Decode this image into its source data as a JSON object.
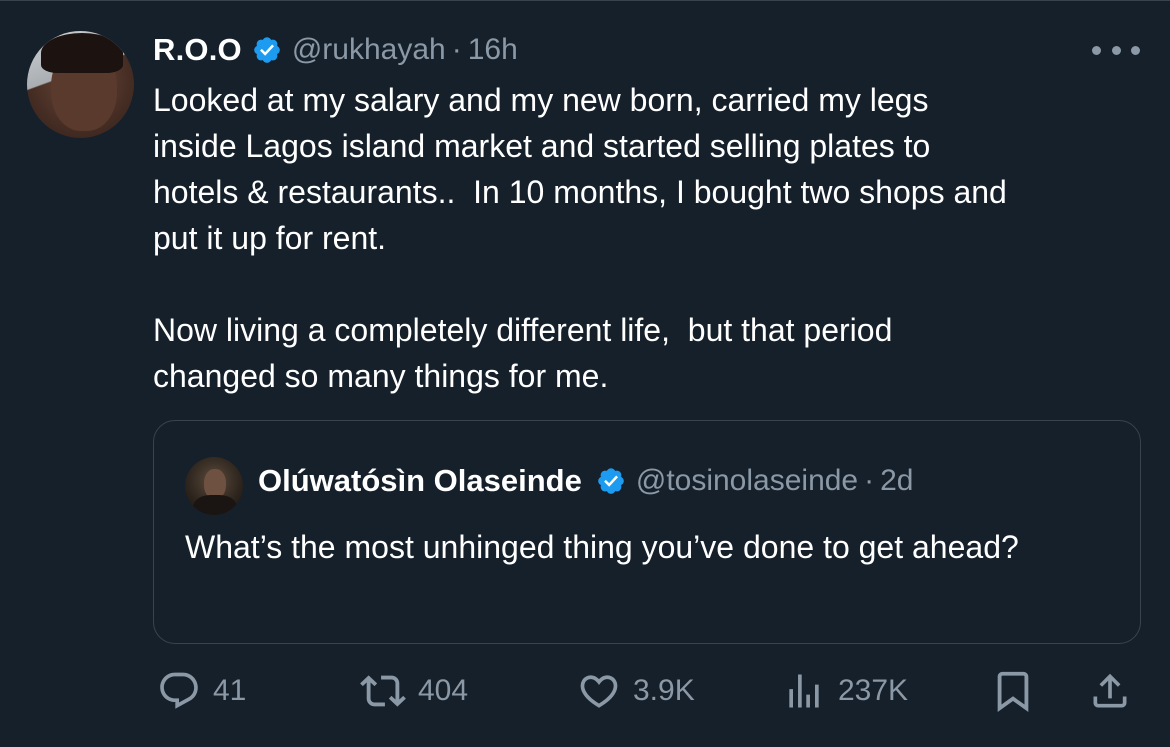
{
  "tweet": {
    "author_name": "R.O.O",
    "handle": "@rukhayah",
    "separator": "·",
    "time": "16h",
    "text": "Looked at my salary and my new born, carried my legs\ninside Lagos island market and started selling plates to\nhotels & restaurants..  In 10 months, I bought two shops and\nput it up for rent.\n\nNow living a completely different life,  but that period\nchanged so many things for me."
  },
  "quoted": {
    "author_name": "Olúwatósìn Olaseinde",
    "handle": "@tosinolaseinde",
    "separator": "·",
    "time": "2d",
    "text": "What’s the most unhinged thing you’ve done to get ahead?"
  },
  "actions": {
    "replies": "41",
    "reposts": "404",
    "likes": "3.9K",
    "views": "237K"
  },
  "colors": {
    "background": "#15202b",
    "muted": "#8b98a5",
    "verified": "#1d9bf0",
    "border": "#38444d"
  },
  "icons": [
    "verified-badge-icon",
    "more-icon",
    "reply-icon",
    "repost-icon",
    "like-icon",
    "views-icon",
    "bookmark-icon",
    "share-icon"
  ]
}
